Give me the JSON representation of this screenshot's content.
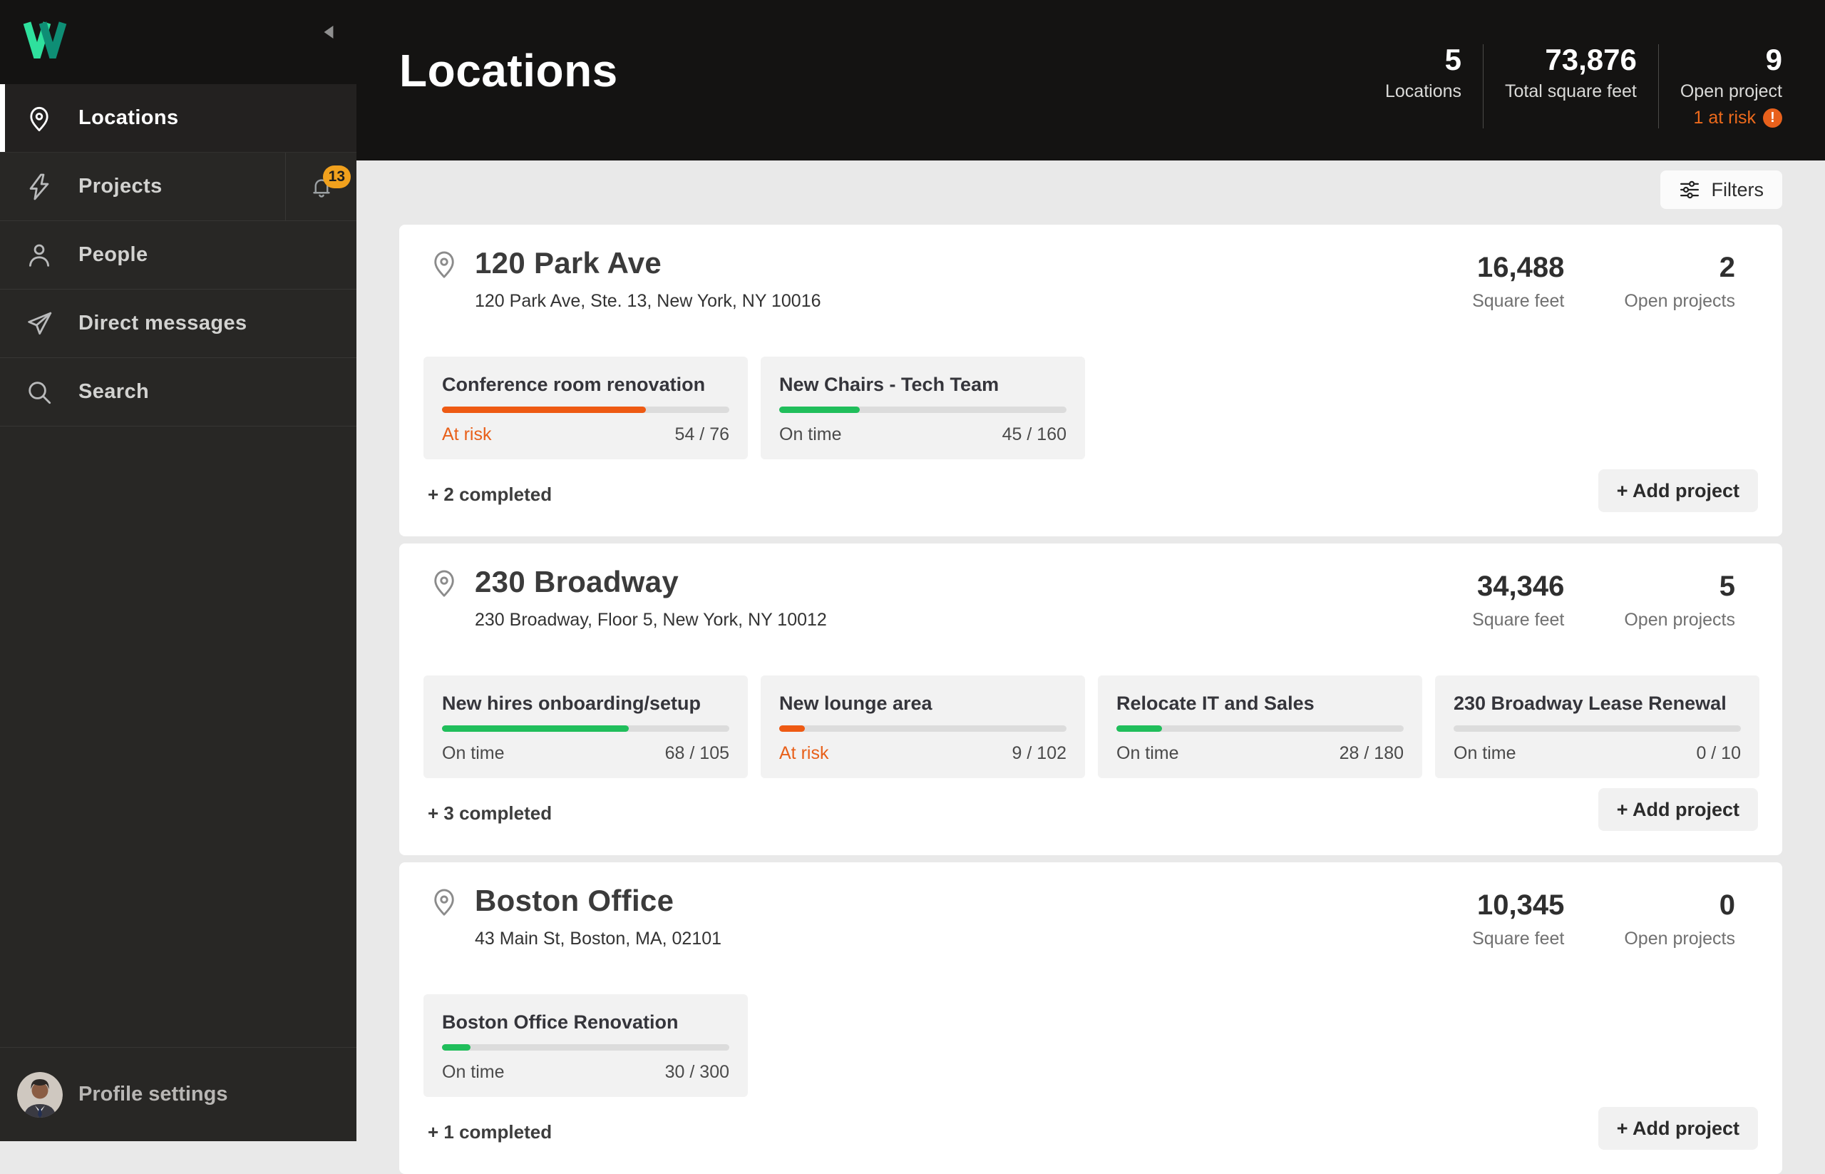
{
  "app": {
    "logo_letter": "W"
  },
  "sidebar": {
    "items": [
      {
        "label": "Locations",
        "icon": "location-pin",
        "active": true
      },
      {
        "label": "Projects",
        "icon": "lightning",
        "badge": "13"
      },
      {
        "label": "People",
        "icon": "person"
      },
      {
        "label": "Direct messages",
        "icon": "paper-plane"
      },
      {
        "label": "Search",
        "icon": "magnifier"
      }
    ],
    "profile_label": "Profile settings"
  },
  "header": {
    "title": "Locations",
    "stats": [
      {
        "value": "5",
        "label": "Locations"
      },
      {
        "value": "73,876",
        "label": "Total square feet"
      },
      {
        "value": "9",
        "label": "Open project",
        "alert": "1 at risk"
      }
    ]
  },
  "toolbar": {
    "filters_label": "Filters"
  },
  "shared": {
    "square_feet_label": "Square feet",
    "open_projects_label": "Open projects",
    "add_project_label": "+ Add project"
  },
  "locations": [
    {
      "name": "120 Park Ave",
      "address": "120 Park Ave, Ste. 13, New York, NY 10016",
      "square_feet": "16,488",
      "open_projects": "2",
      "completed_label": "+ 2 completed",
      "projects": [
        {
          "title": "Conference room renovation",
          "status": "At risk",
          "status_type": "at-risk",
          "progress": "54 / 76",
          "percent": 71
        },
        {
          "title": "New Chairs - Tech Team",
          "status": "On time",
          "status_type": "on-time",
          "progress": "45 / 160",
          "percent": 28
        }
      ]
    },
    {
      "name": "230 Broadway",
      "address": "230 Broadway, Floor 5, New York, NY 10012",
      "square_feet": "34,346",
      "open_projects": "5",
      "completed_label": "+ 3 completed",
      "projects": [
        {
          "title": "New hires onboarding/setup",
          "status": "On time",
          "status_type": "on-time",
          "progress": "68 / 105",
          "percent": 65
        },
        {
          "title": "New lounge area",
          "status": "At risk",
          "status_type": "at-risk",
          "progress": "9 / 102",
          "percent": 9
        },
        {
          "title": "Relocate IT and Sales",
          "status": "On time",
          "status_type": "on-time",
          "progress": "28 / 180",
          "percent": 16
        },
        {
          "title": "230 Broadway Lease Renewal",
          "status": "On time",
          "status_type": "on-time",
          "progress": "0 / 10",
          "percent": 0
        }
      ]
    },
    {
      "name": "Boston Office",
      "address": "43 Main St, Boston, MA, 02101",
      "square_feet": "10,345",
      "open_projects": "0",
      "completed_label": "+ 1 completed",
      "projects": [
        {
          "title": "Boston Office Renovation",
          "status": "On time",
          "status_type": "on-time",
          "progress": "30 / 300",
          "percent": 10
        }
      ]
    }
  ],
  "colors": {
    "brand_green": "#2FE09D",
    "brand_teal": "#0E8E75",
    "on_time_green": "#20BE5B",
    "at_risk_orange": "#EE5A13",
    "badge_orange": "#F1A11D",
    "alert_orange": "#ED6A1C",
    "topbar_bg": "#141312",
    "sidebar_bg": "#282725",
    "content_bg": "#E9E9E9"
  }
}
